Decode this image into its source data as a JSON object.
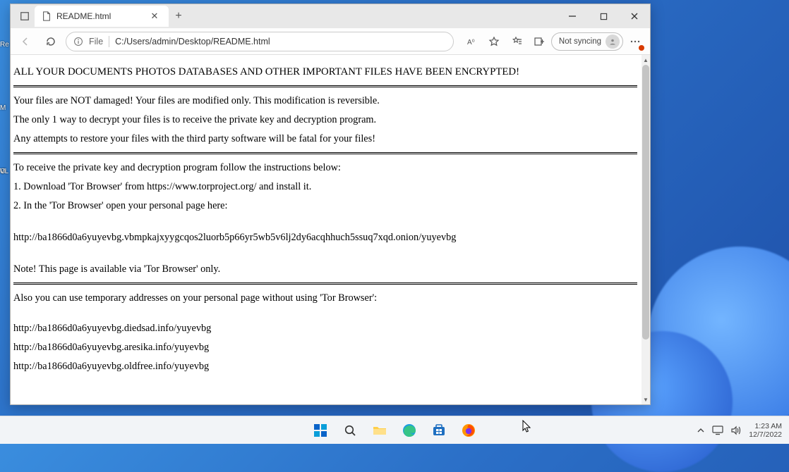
{
  "browser": {
    "tab_title": "README.html",
    "addr_scheme_label": "File",
    "addr_path": "C:/Users/admin/Desktop/README.html",
    "sync_label": "Not syncing"
  },
  "page": {
    "headline": "ALL YOUR DOCUMENTS PHOTOS DATABASES AND OTHER IMPORTANT FILES HAVE BEEN ENCRYPTED!",
    "p1": "Your files are NOT damaged! Your files are modified only. This modification is reversible.",
    "p2": "The only 1 way to decrypt your files is to receive the private key and decryption program.",
    "p3": "Any attempts to restore your files with the third party software will be fatal for your files!",
    "p4": "To receive the private key and decryption program follow the instructions below:",
    "p5": "1. Download 'Tor Browser' from https://www.torproject.org/ and install it.",
    "p6": "2. In the 'Tor Browser' open your personal page here:",
    "onion": "http://ba1866d0a6yuyevbg.vbmpkajxyygcqos2luorb5p66yr5wb5v6lj2dy6acqhhuch5ssuq7xqd.onion/yuyevbg",
    "note": "Note! This page is available via 'Tor Browser' only.",
    "p7": "Also you can use temporary addresses on your personal page without using 'Tor Browser':",
    "url1": "http://ba1866d0a6yuyevbg.diedsad.info/yuyevbg",
    "url2": "http://ba1866d0a6yuyevbg.aresika.info/yuyevbg",
    "url3": "http://ba1866d0a6yuyevbg.oldfree.info/yuyevbg"
  },
  "desk": {
    "f1": "Re",
    "f2": "M",
    "f3": "O",
    "f4": "VL"
  },
  "systray": {
    "time": "1:23 AM",
    "date": "12/7/2022"
  }
}
